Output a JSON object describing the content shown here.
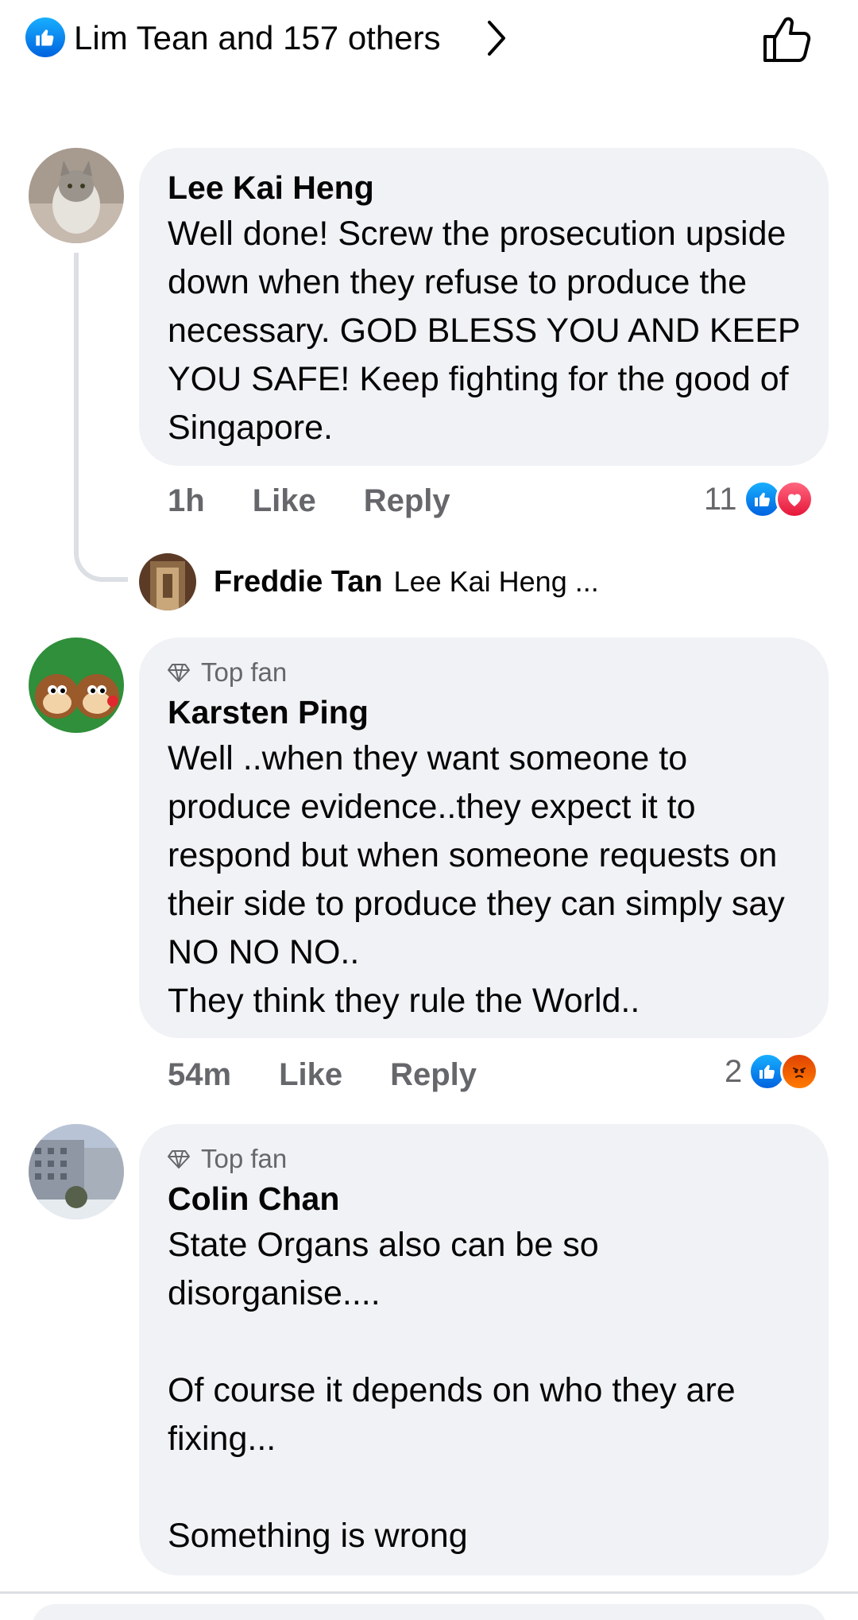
{
  "header": {
    "reactors_text": "Lim Tean and 157 others"
  },
  "comments": [
    {
      "author": "Lee Kai Heng",
      "text": "Well done! Screw the prosecution upside down when they refuse to produce the necessary. GOD BLESS YOU AND KEEP YOU SAFE! Keep fighting for the good of Singapore.",
      "time": "1h",
      "like_label": "Like",
      "reply_label": "Reply",
      "reaction_count": "11",
      "reactions": [
        "like",
        "love"
      ],
      "reply_preview": {
        "author": "Freddie Tan",
        "text": "Lee Kai Heng ..."
      }
    },
    {
      "badge": "Top fan",
      "author": "Karsten Ping",
      "text": "Well ..when they want someone to produce evidence..they expect it to respond but when someone requests on their side to produce they can simply say NO NO NO..\nThey think they rule the World..",
      "time": "54m",
      "like_label": "Like",
      "reply_label": "Reply",
      "reaction_count": "2",
      "reactions": [
        "like",
        "angry"
      ]
    },
    {
      "badge": "Top fan",
      "author": "Colin Chan",
      "text": "State Organs also can be so disorganise....\n\nOf course it depends on who they are fixing...\n\nSomething is wrong"
    }
  ],
  "colors": {
    "bubble": "#f0f2f5",
    "meta_text": "#65676b",
    "like_blue": "#0866ff",
    "love_red": "#f33e58",
    "angry_orange": "#f7714b"
  }
}
